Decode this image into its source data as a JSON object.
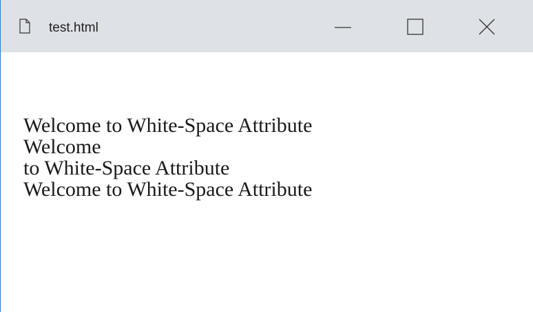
{
  "window": {
    "tab_title": "test.html",
    "icons": {
      "page": "page-icon",
      "minimize": "minimize-icon",
      "maximize": "maximize-icon",
      "close": "close-icon"
    }
  },
  "content": {
    "lines": [
      "Welcome to White-Space Attribute",
      "Welcome",
      "to White-Space Attribute",
      "Welcome to White-Space Attribute"
    ]
  },
  "colors": {
    "titlebar_bg": "#dee1e6",
    "window_border": "#2b7cd3",
    "text": "#1a1a1a"
  }
}
